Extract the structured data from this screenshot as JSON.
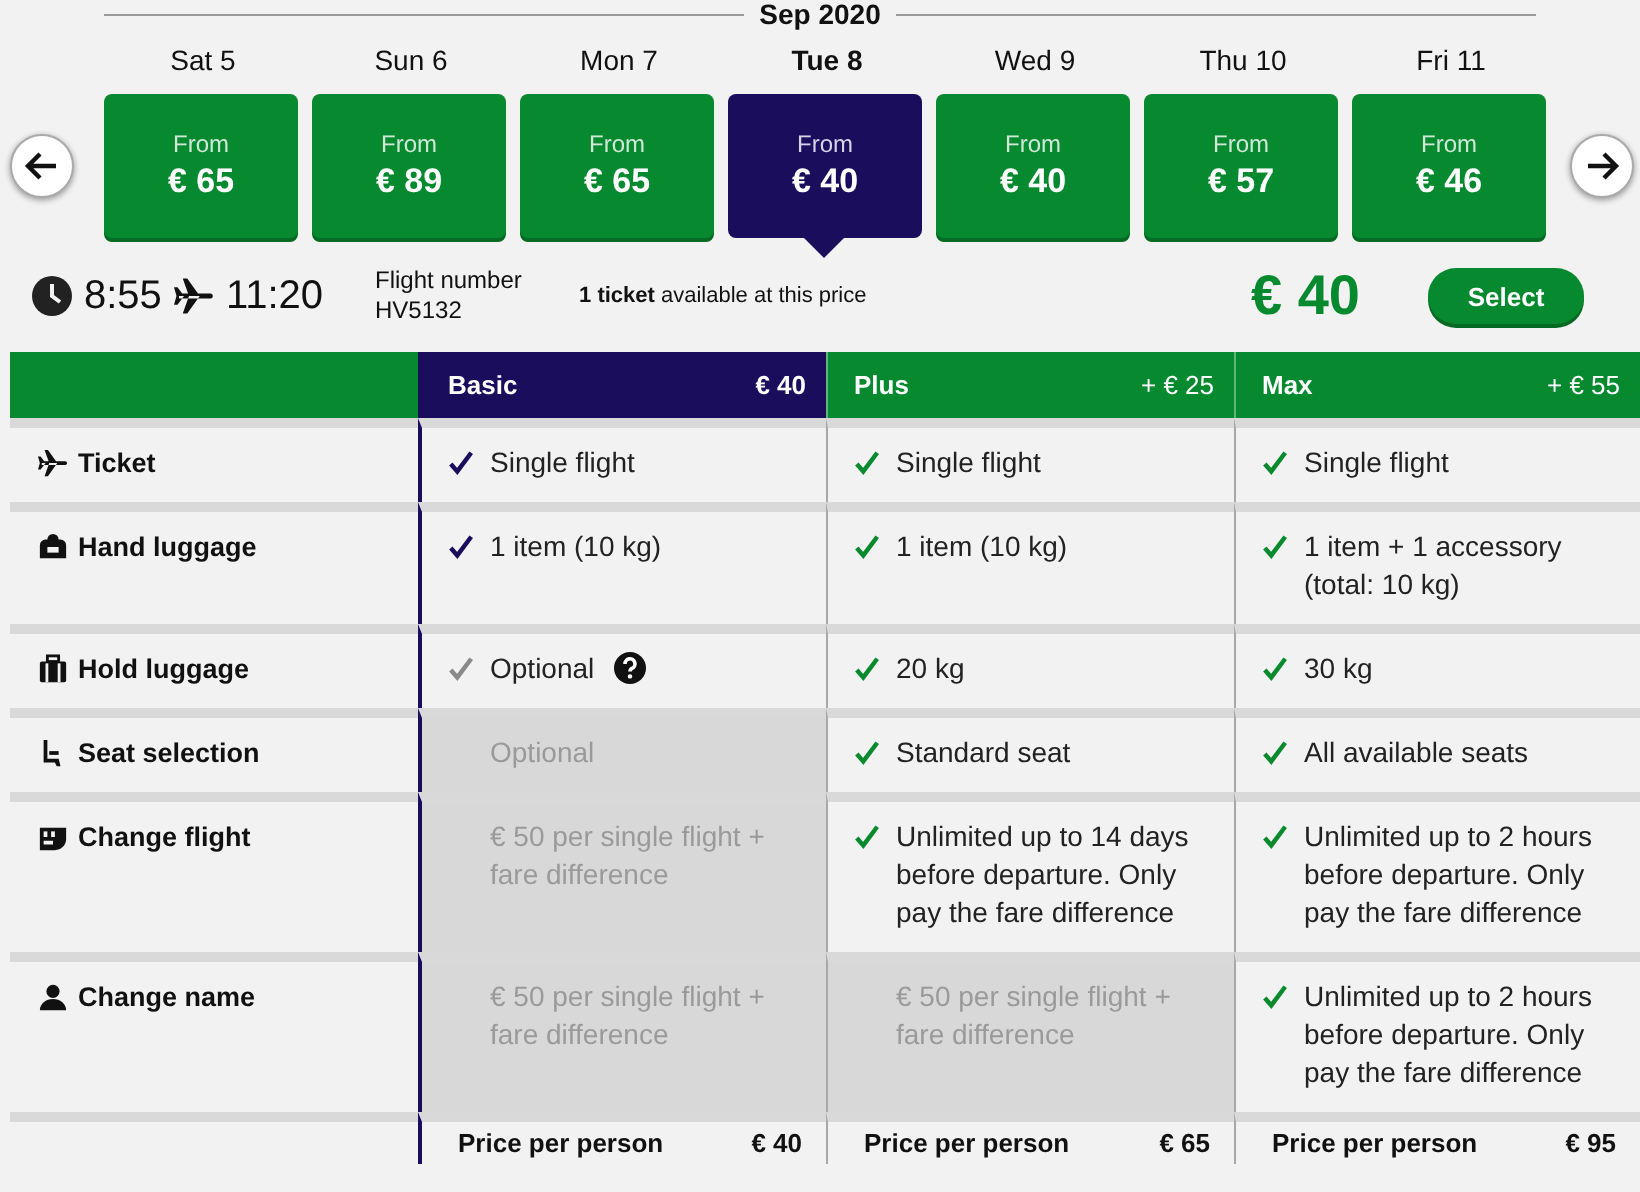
{
  "month": "Sep 2020",
  "days": [
    {
      "day": "Sat 5",
      "from": "From",
      "price": "€ 65",
      "selected": false
    },
    {
      "day": "Sun 6",
      "from": "From",
      "price": "€ 89",
      "selected": false
    },
    {
      "day": "Mon 7",
      "from": "From",
      "price": "€ 65",
      "selected": false
    },
    {
      "day": "Tue 8",
      "from": "From",
      "price": "€ 40",
      "selected": true
    },
    {
      "day": "Wed 9",
      "from": "From",
      "price": "€ 40",
      "selected": false
    },
    {
      "day": "Thu 10",
      "from": "From",
      "price": "€ 57",
      "selected": false
    },
    {
      "day": "Fri 11",
      "from": "From",
      "price": "€ 46",
      "selected": false
    }
  ],
  "flight": {
    "departure": "8:55",
    "arrival": "11:20",
    "number_label": "Flight number",
    "number": "HV5132",
    "availability": "**1 ticket** available at this price",
    "price": "€ 40",
    "select_button": "Select"
  },
  "plans": [
    {
      "name": "Basic",
      "price": "€ 40",
      "selected": true,
      "footer_label": "Price per person",
      "footer_price": "€ 40"
    },
    {
      "name": "Plus",
      "price": "+ € 25",
      "selected": false,
      "footer_label": "Price per person",
      "footer_price": "€ 65"
    },
    {
      "name": "Max",
      "price": "+ € 55",
      "selected": false,
      "footer_label": "Price per person",
      "footer_price": "€ 95"
    }
  ],
  "rows": [
    {
      "kind": "plane",
      "label": "Ticket",
      "cells": [
        {
          "text": "Single flight",
          "available": true,
          "included": true
        },
        {
          "text": "Single flight",
          "available": true,
          "included": true
        },
        {
          "text": "Single flight",
          "available": true,
          "included": true
        }
      ]
    },
    {
      "kind": "backpack",
      "label": "Hand luggage",
      "cells": [
        {
          "text": "1 item (10 kg)",
          "available": true,
          "included": true
        },
        {
          "text": "1 item (10 kg)",
          "available": true,
          "included": true
        },
        {
          "text": "1 item + 1 accessory (total: 10 kg)",
          "available": true,
          "included": true
        }
      ]
    },
    {
      "kind": "suitcase",
      "label": "Hold luggage",
      "cells": [
        {
          "text": "Optional",
          "available": true,
          "included": false,
          "help": true
        },
        {
          "text": "20 kg",
          "available": true,
          "included": true
        },
        {
          "text": "30 kg",
          "available": true,
          "included": true
        }
      ]
    },
    {
      "kind": "seat",
      "label": "Seat selection",
      "cells": [
        {
          "text": "Optional",
          "available": false
        },
        {
          "text": "Standard seat",
          "available": true,
          "included": true
        },
        {
          "text": "All available seats",
          "available": true,
          "included": true
        }
      ]
    },
    {
      "kind": "calendar",
      "label": "Change flight",
      "cells": [
        {
          "text": "€ 50 per single flight + fare difference",
          "available": false
        },
        {
          "text": "Unlimited up to 14 days before departure. Only pay the fare difference",
          "available": true,
          "included": true
        },
        {
          "text": "Unlimited up to 2 hours before departure. Only pay the fare difference",
          "available": true,
          "included": true
        }
      ]
    },
    {
      "kind": "person",
      "label": "Change name",
      "cells": [
        {
          "text": "€ 50 per single flight + fare difference",
          "available": false
        },
        {
          "text": "€ 50 per single flight + fare difference",
          "available": false
        },
        {
          "text": "Unlimited up to 2 hours before departure. Only pay the fare difference",
          "available": true,
          "included": true
        }
      ]
    }
  ]
}
